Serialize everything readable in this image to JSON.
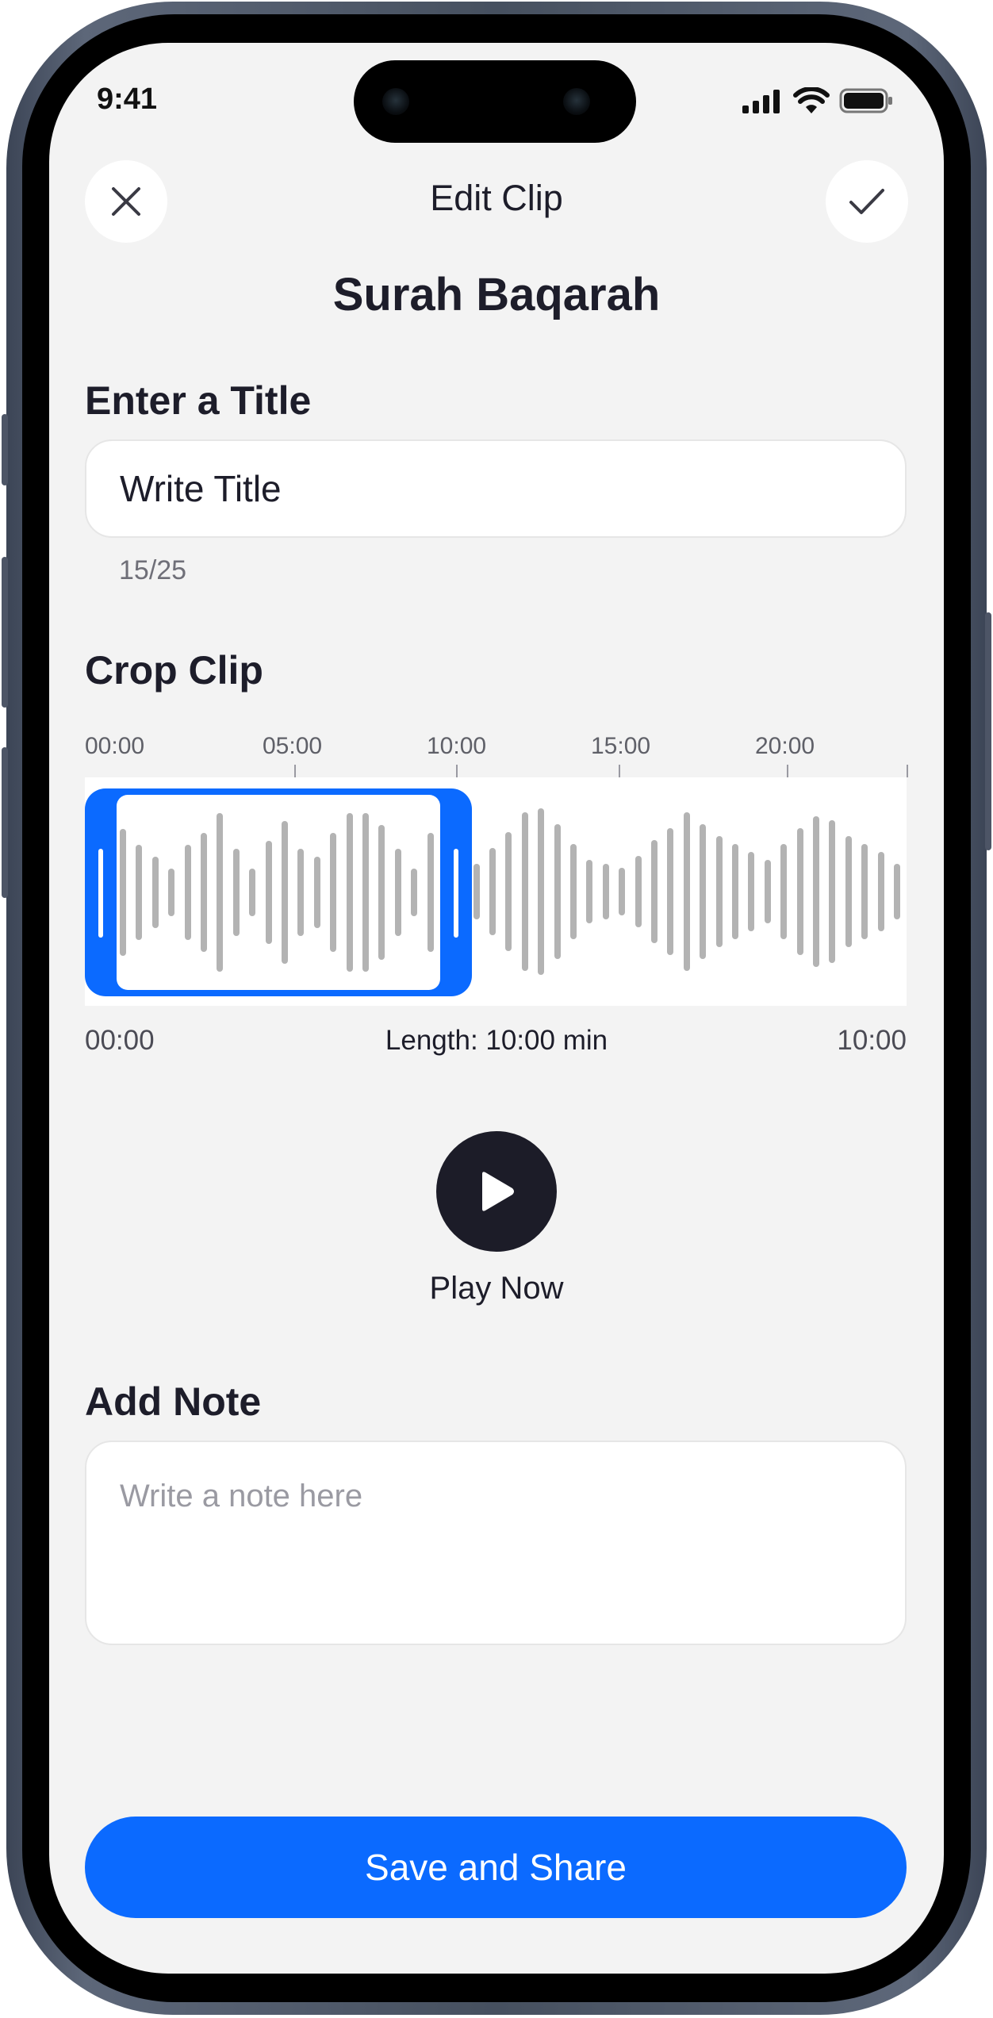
{
  "status_bar": {
    "time": "9:41"
  },
  "header": {
    "title": "Edit Clip"
  },
  "clip": {
    "title": "Surah Baqarah"
  },
  "title_section": {
    "label": "Enter a Title",
    "placeholder": "Write Title",
    "counter": "15/25"
  },
  "crop_section": {
    "label": "Crop Clip",
    "timeline_ticks": [
      "00:00",
      "05:00",
      "10:00",
      "15:00",
      "20:00"
    ],
    "selection_start": "00:00",
    "selection_end": "10:00",
    "length_label": "Length: 10:00 min"
  },
  "player": {
    "play_label": "Play Now"
  },
  "note_section": {
    "label": "Add Note",
    "placeholder": "Write a note here"
  },
  "footer": {
    "save_label": "Save and Share"
  },
  "colors": {
    "accent": "#0B6AFF",
    "dark": "#1C1C28",
    "wave": "#B3B3B3",
    "background": "#F3F3F3"
  },
  "icons": [
    "close-icon",
    "check-icon",
    "play-icon",
    "signal-icon",
    "wifi-icon",
    "battery-icon"
  ]
}
